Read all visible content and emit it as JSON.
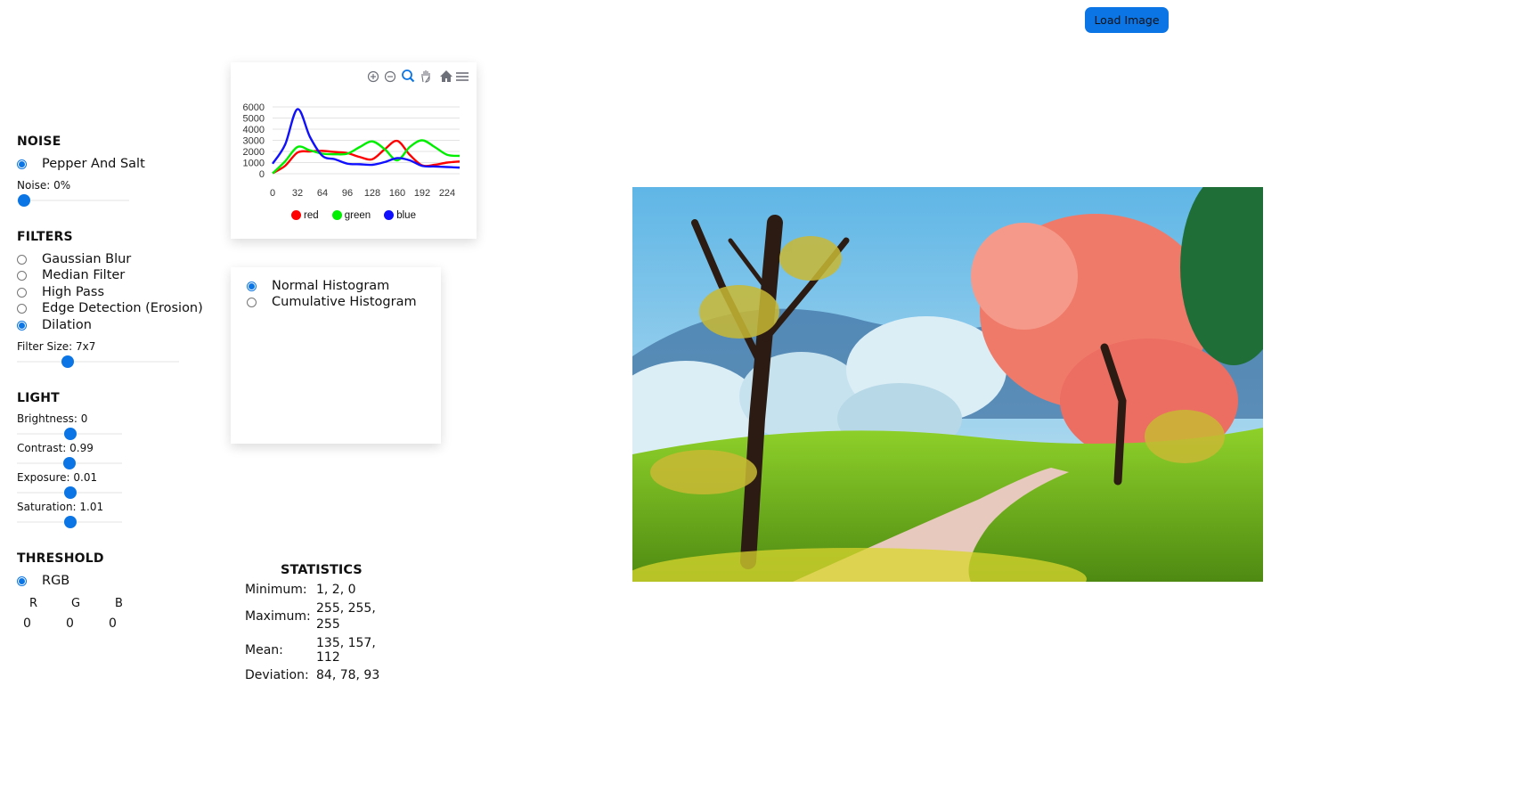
{
  "header": {
    "load_button": "Load Image"
  },
  "noise": {
    "title": "NOISE",
    "options": [
      {
        "label": "Pepper And Salt",
        "checked": true
      }
    ],
    "slider": {
      "label": "Noise: 0%",
      "value": 0
    }
  },
  "filters": {
    "title": "FILTERS",
    "options": [
      {
        "label": "Gaussian Blur",
        "checked": false
      },
      {
        "label": "Median Filter",
        "checked": false
      },
      {
        "label": "High Pass",
        "checked": false
      },
      {
        "label": "Edge Detection (Erosion)",
        "checked": false
      },
      {
        "label": "Dilation",
        "checked": true
      }
    ],
    "slider": {
      "label": "Filter Size: 7x7",
      "fraction": 0.3
    }
  },
  "light": {
    "title": "LIGHT",
    "sliders": [
      {
        "label": "Brightness: 0",
        "fraction": 0.5
      },
      {
        "label": "Contrast: 0.99",
        "fraction": 0.5
      },
      {
        "label": "Exposure: 0.01",
        "fraction": 0.5
      },
      {
        "label": "Saturation: 1.01",
        "fraction": 0.5
      }
    ]
  },
  "threshold": {
    "title": "THRESHOLD",
    "option": {
      "label": "RGB",
      "checked": true
    },
    "channels": [
      "R",
      "G",
      "B"
    ],
    "values": [
      "0",
      "0",
      "0"
    ]
  },
  "histogram_mode": {
    "options": [
      {
        "label": "Normal Histogram",
        "checked": true
      },
      {
        "label": "Cumulative Histogram",
        "checked": false
      }
    ]
  },
  "statistics": {
    "title": "STATISTICS",
    "rows": [
      {
        "label": "Minimum:",
        "value": "1, 2, 0"
      },
      {
        "label": "Maximum:",
        "value": "255, 255, 255"
      },
      {
        "label": "Mean:",
        "value": "135, 157, 112"
      },
      {
        "label": "Deviation:",
        "value": "84, 78, 93"
      }
    ]
  },
  "toolbar_icons": [
    "zoom-in-icon",
    "zoom-out-icon",
    "zoom-select-icon",
    "pan-icon",
    "home-icon",
    "menu-icon"
  ],
  "chart_data": {
    "type": "line",
    "x": [
      0,
      16,
      32,
      48,
      64,
      80,
      96,
      112,
      128,
      144,
      160,
      176,
      192,
      208,
      224,
      240
    ],
    "x_ticks": [
      0,
      32,
      64,
      96,
      128,
      160,
      192,
      224
    ],
    "y_ticks": [
      0,
      1000,
      2000,
      3000,
      4000,
      5000,
      6000
    ],
    "ylim": [
      0,
      6000
    ],
    "xlim": [
      0,
      240
    ],
    "grid": true,
    "legend_position": "bottom",
    "series": [
      {
        "name": "red",
        "color": "#ff0000",
        "values": [
          50,
          700,
          1900,
          2000,
          2050,
          1950,
          1850,
          1500,
          1300,
          2200,
          2950,
          1700,
          750,
          800,
          1000,
          1100
        ]
      },
      {
        "name": "green",
        "color": "#00ee00",
        "values": [
          30,
          1100,
          2400,
          2100,
          1800,
          1750,
          1800,
          2400,
          2900,
          2200,
          1200,
          2400,
          3000,
          2400,
          1700,
          1600
        ]
      },
      {
        "name": "blue",
        "color": "#1010ff",
        "values": [
          900,
          2600,
          5800,
          3300,
          1600,
          1300,
          900,
          850,
          800,
          1050,
          1400,
          1200,
          700,
          650,
          600,
          550
        ]
      }
    ]
  }
}
